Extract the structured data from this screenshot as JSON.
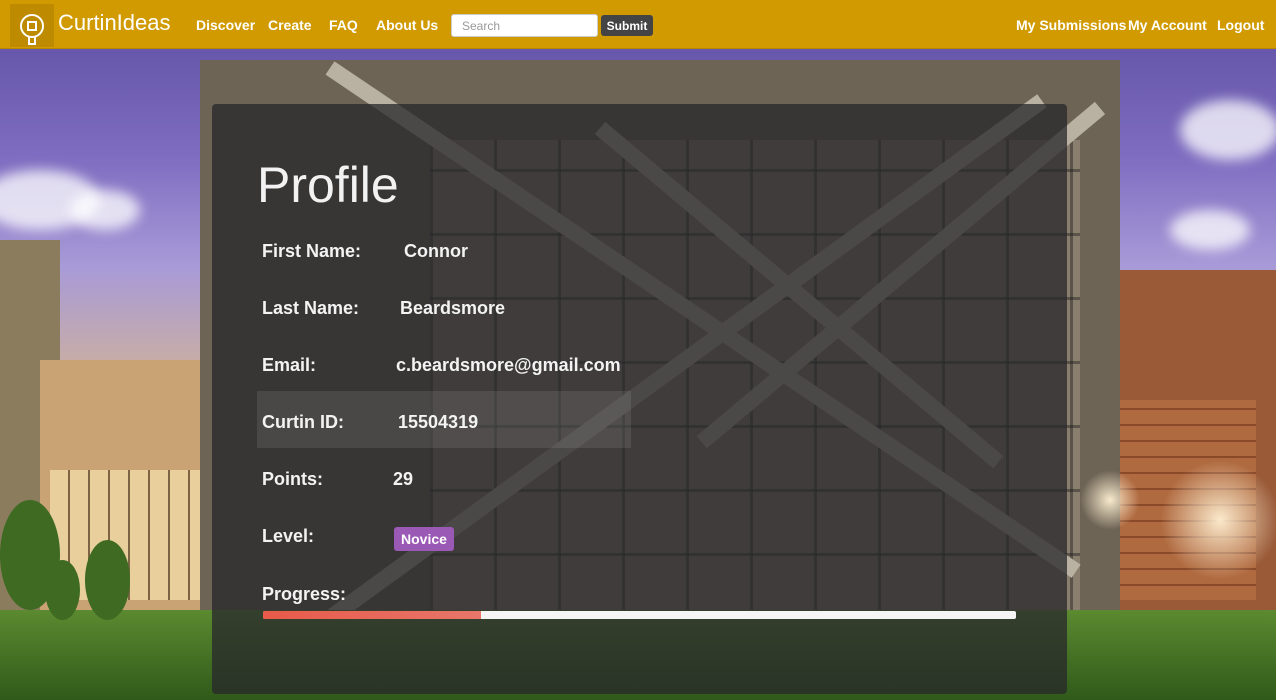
{
  "navbar": {
    "brand": "CurtinIdeas",
    "links": [
      {
        "label": "Discover"
      },
      {
        "label": "Create"
      },
      {
        "label": "FAQ"
      },
      {
        "label": "About Us"
      }
    ],
    "search_placeholder": "Search",
    "search_value": "",
    "submit_label": "Submit",
    "right_links": [
      {
        "label": "My Submissions"
      },
      {
        "label": "My Account"
      },
      {
        "label": "Logout"
      }
    ],
    "logo_icon": "lightbulb-icon"
  },
  "profile": {
    "title": "Profile",
    "first_name_label": "First Name:",
    "first_name": "Connor",
    "last_name_label": "Last Name:",
    "last_name": "Beardsmore",
    "email_label": "Email:",
    "email": "c.beardsmore@gmail.com",
    "curtin_id_label": "Curtin ID:",
    "curtin_id": "15504319",
    "points_label": "Points:",
    "points": "29",
    "level_label": "Level:",
    "level": "Novice",
    "progress_label": "Progress:",
    "progress_percent": 29
  },
  "colors": {
    "navbar": "#d09a00",
    "badge": "#9b59b6",
    "progress": "#e85a4a"
  }
}
